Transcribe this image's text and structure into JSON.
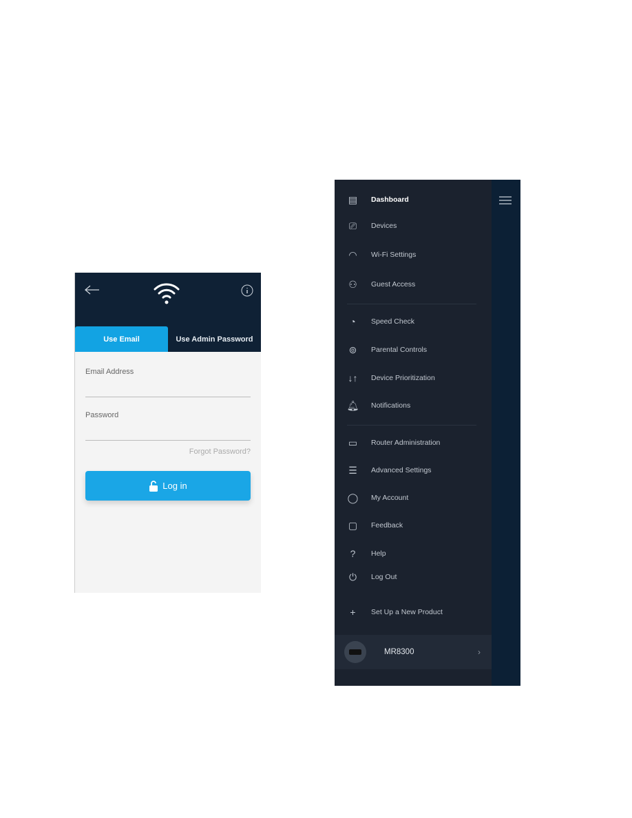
{
  "login": {
    "tabs": [
      "Use Email",
      "Use Admin Password"
    ],
    "email_label": "Email Address",
    "email_value": "",
    "password_label": "Password",
    "password_value": "",
    "forgot": "Forgot Password?",
    "login_button": "Log in",
    "accent": "#12a3e3"
  },
  "menu": {
    "items": [
      {
        "label": "Dashboard",
        "icon": "dashboard-icon"
      },
      {
        "label": "Devices",
        "icon": "devices-icon"
      },
      {
        "label": "Wi-Fi Settings",
        "icon": "wifi-icon"
      },
      {
        "label": "Guest Access",
        "icon": "guest-icon"
      },
      {
        "label": "Speed Check",
        "icon": "speedometer-icon"
      },
      {
        "label": "Parental Controls",
        "icon": "lock-icon"
      },
      {
        "label": "Device Prioritization",
        "icon": "arrows-icon"
      },
      {
        "label": "Notifications",
        "icon": "bell-icon"
      },
      {
        "label": "Router Administration",
        "icon": "router-icon"
      },
      {
        "label": "Advanced Settings",
        "icon": "sliders-icon"
      },
      {
        "label": "My Account",
        "icon": "user-icon"
      },
      {
        "label": "Feedback",
        "icon": "chat-icon"
      },
      {
        "label": "Help",
        "icon": "help-icon"
      },
      {
        "label": "Log Out",
        "icon": "power-icon"
      },
      {
        "label": "Set Up a New Product",
        "icon": "plus-icon"
      }
    ],
    "device": "MR8300"
  }
}
